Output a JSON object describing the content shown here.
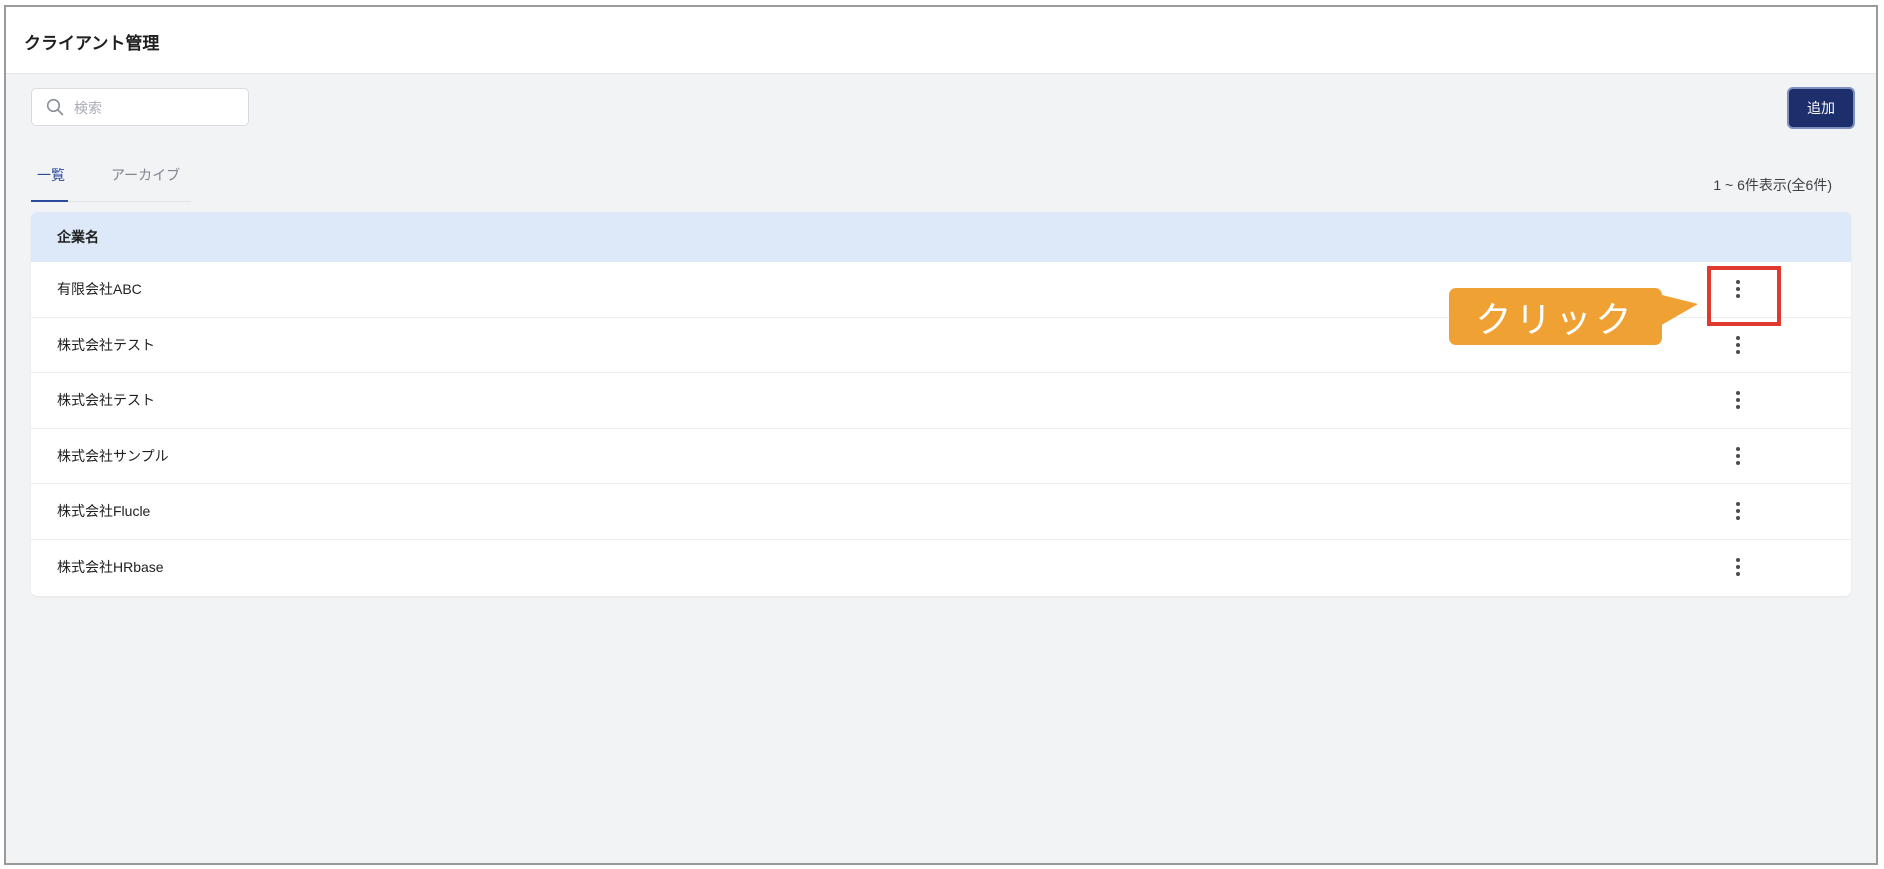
{
  "header": {
    "title": "クライアント管理"
  },
  "search": {
    "placeholder": "検索",
    "icon": "search-icon"
  },
  "toolbar": {
    "add_label": "追加"
  },
  "tabs": [
    {
      "label": "一覧",
      "active": true
    },
    {
      "label": "アーカイブ",
      "active": false
    }
  ],
  "pagination": {
    "summary": "1 ~ 6件表示(全6件)"
  },
  "table": {
    "columns": [
      "企業名"
    ],
    "rows": [
      {
        "name": "有限会社ABC"
      },
      {
        "name": "株式会社テスト"
      },
      {
        "name": "株式会社テスト"
      },
      {
        "name": "株式会社サンプル"
      },
      {
        "name": "株式会社Flucle"
      },
      {
        "name": "株式会社HRbase"
      }
    ],
    "row_action_icon": "more-vertical-icon"
  },
  "annotation": {
    "callout_text": "クリック",
    "callout_color": "#f0a133",
    "highlight_color": "#e03a2f"
  },
  "colors": {
    "accent": "#1c2e6b",
    "table_header_bg": "#dde8f8",
    "active_tab": "#2b4a9a"
  }
}
